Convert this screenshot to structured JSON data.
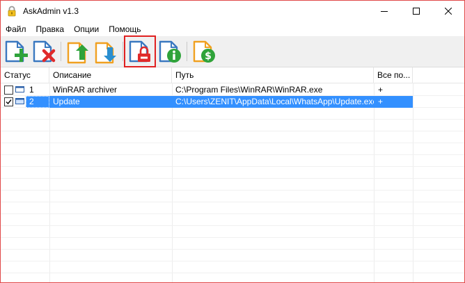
{
  "window": {
    "title": "AskAdmin v1.3"
  },
  "menu": {
    "items": [
      "Файл",
      "Правка",
      "Опции",
      "Помощь"
    ]
  },
  "toolbar": {
    "buttons": [
      {
        "icon": "add-icon"
      },
      {
        "icon": "remove-icon"
      },
      {
        "icon": "import-icon"
      },
      {
        "icon": "export-icon"
      },
      {
        "icon": "lock-icon",
        "highlighted": true
      },
      {
        "icon": "info-icon"
      },
      {
        "icon": "donate-icon"
      }
    ]
  },
  "table": {
    "headers": {
      "status": "Статус",
      "description": "Описание",
      "path": "Путь",
      "all_users": "Все по..."
    },
    "rows": [
      {
        "checked": false,
        "number": "1",
        "description": "WinRAR archiver",
        "path": "C:\\Program Files\\WinRAR\\WinRAR.exe",
        "all_users": "+",
        "selected": false
      },
      {
        "checked": true,
        "number": "2",
        "description": "Update",
        "path": "C:\\Users\\ZENIT\\AppData\\Local\\WhatsApp\\Update.exe",
        "all_users": "+",
        "selected": true
      }
    ]
  },
  "colors": {
    "selection": "#3390ff",
    "highlight_box": "#e02020",
    "window_border": "#e04848"
  }
}
